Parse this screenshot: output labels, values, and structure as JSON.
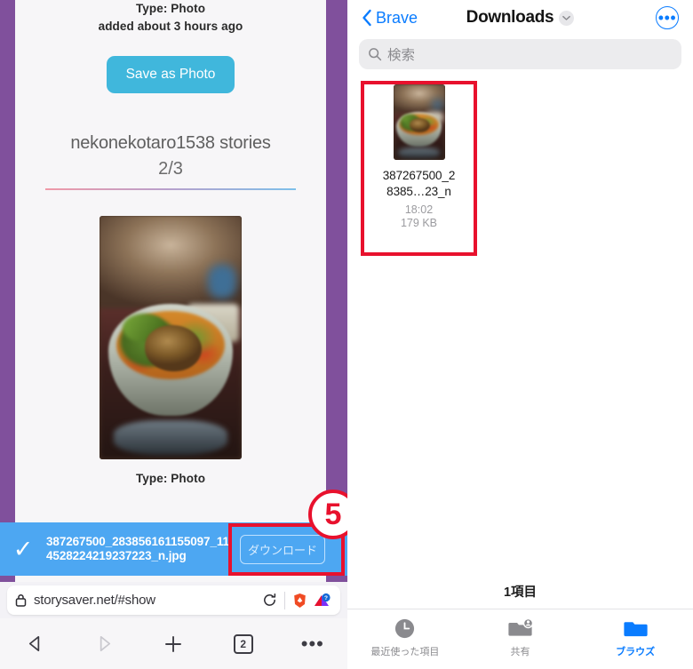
{
  "left_panel": {
    "page": {
      "type_label": "Type: Photo",
      "added_label": "added about 3 hours ago",
      "save_button": "Save as Photo",
      "story_title": "nekonekotaro1538 stories",
      "story_count": "2/3",
      "type_label_2": "Type: Photo"
    },
    "download_strip": {
      "check_icon": "✓",
      "filename": "387267500_283856161155097_114528224219237223_n.jpg",
      "download_button": "ダウンロード",
      "highlight_color": "#e8112d",
      "background_color": "#4da7f2"
    },
    "step_badge": "5",
    "browser": {
      "url": "storysaver.net/#show",
      "lock_icon": "lock-icon",
      "reload_icon": "reload-icon",
      "brave_shield_icon": "brave-lion-icon",
      "extension_icon": "triangle-badge-icon",
      "nav": {
        "back": "back-arrow",
        "forward": "forward-arrow",
        "new_tab": "+",
        "tab_count": "2",
        "menu": "•••"
      }
    },
    "accent_purple": "#80509c"
  },
  "right_panel": {
    "nav": {
      "back_label": "Brave",
      "title": "Downloads",
      "title_chevron": "chevron-down-icon",
      "more_icon": "ellipsis-circle-icon"
    },
    "search": {
      "placeholder": "検索",
      "icon": "search-icon"
    },
    "files": [
      {
        "name_line_1": "387267500_2",
        "name_line_2": "8385…23_n",
        "time": "18:02",
        "size": "179 KB",
        "thumbnail": "food-bowl-photo"
      }
    ],
    "item_count": "1項目",
    "tabs": [
      {
        "label": "最近使った項目",
        "icon": "clock-icon",
        "active": false
      },
      {
        "label": "共有",
        "icon": "shared-folder-icon",
        "active": false
      },
      {
        "label": "ブラウズ",
        "icon": "folder-icon",
        "active": true
      }
    ],
    "accent_color": "#0a7cff",
    "highlight_color": "#e8112d"
  }
}
